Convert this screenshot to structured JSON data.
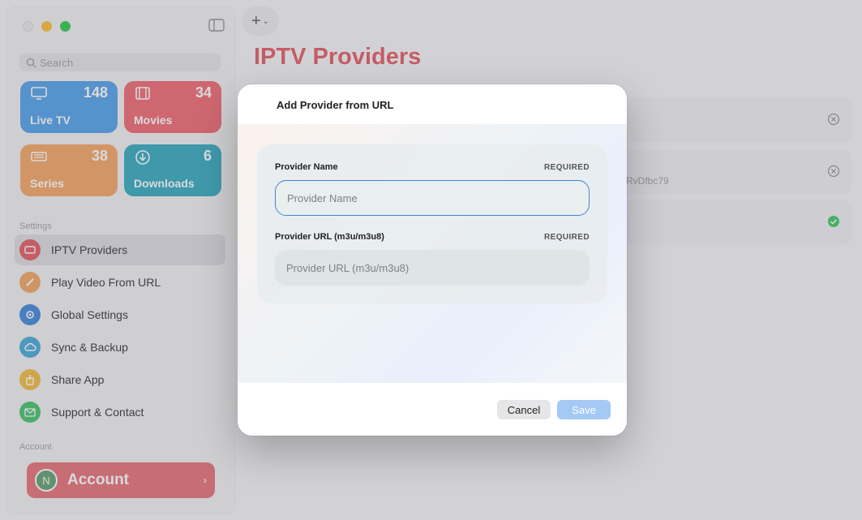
{
  "sidebar": {
    "search_placeholder": "Search",
    "tiles": {
      "live_tv": {
        "label": "Live TV",
        "count": "148"
      },
      "movies": {
        "label": "Movies",
        "count": "34"
      },
      "series": {
        "label": "Series",
        "count": "38"
      },
      "downloads": {
        "label": "Downloads",
        "count": "6"
      }
    },
    "settings_section": "Settings",
    "items": [
      {
        "label": "IPTV Providers"
      },
      {
        "label": "Play Video From URL"
      },
      {
        "label": "Global Settings"
      },
      {
        "label": "Sync & Backup"
      },
      {
        "label": "Share App"
      },
      {
        "label": "Support & Contact"
      }
    ],
    "account_section": "Account",
    "account": {
      "initial": "N",
      "label": "Account"
    }
  },
  "main": {
    "title": "IPTV Providers",
    "rows": [
      {
        "text": ""
      },
      {
        "text": "RvDfbc79"
      },
      {
        "text": ""
      }
    ]
  },
  "modal": {
    "title": "Add Provider from URL",
    "name_label": "Provider Name",
    "name_required": "REQUIRED",
    "name_placeholder": "Provider Name",
    "url_label": "Provider URL (m3u/m3u8)",
    "url_required": "REQUIRED",
    "url_placeholder": "Provider URL (m3u/m3u8)",
    "cancel_label": "Cancel",
    "save_label": "Save"
  },
  "colors": {
    "accent": "#e2545a",
    "focus": "#3d86d8",
    "save_disabled": "#a5c9f5"
  }
}
